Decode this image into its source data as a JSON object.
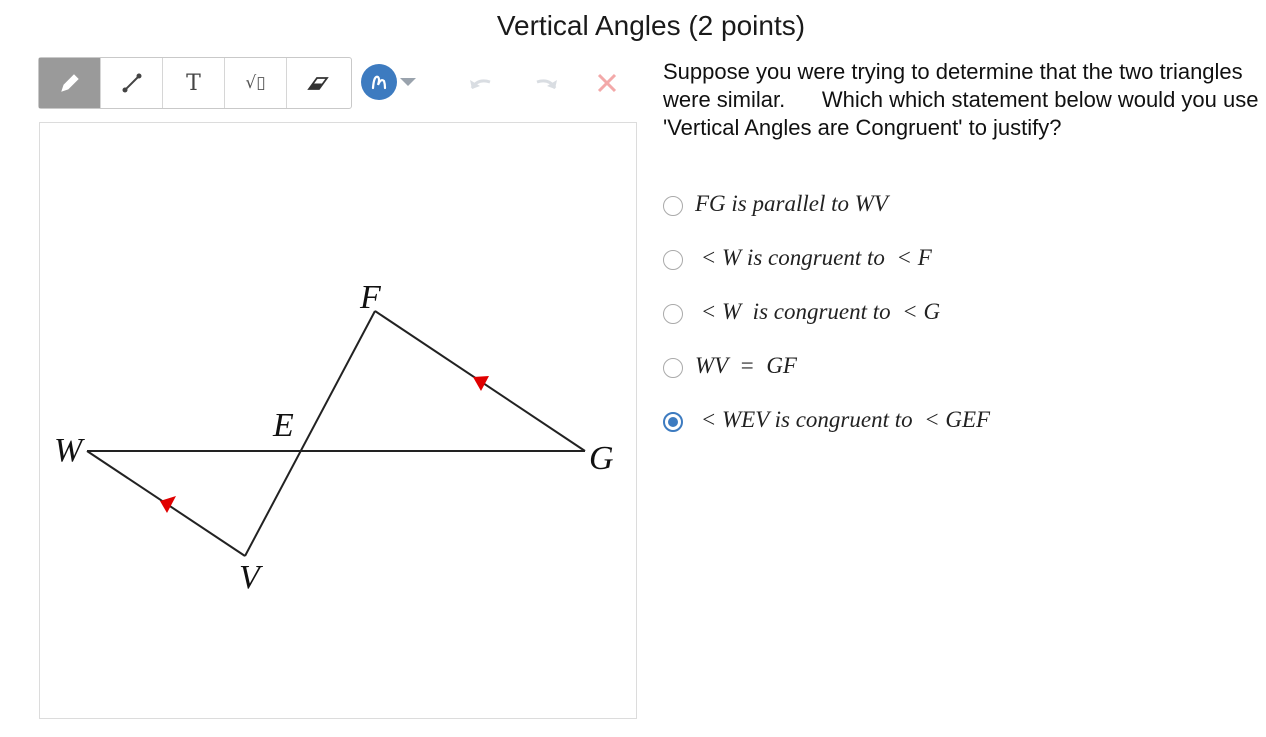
{
  "page": {
    "title": "Vertical Angles (2 points)"
  },
  "toolbar": {
    "tools": [
      {
        "name": "pencil",
        "icon": "pencil-icon",
        "active": true
      },
      {
        "name": "line",
        "icon": "line-icon"
      },
      {
        "name": "text",
        "icon": "text-icon",
        "label": "T"
      },
      {
        "name": "math",
        "icon": "sqrt-icon",
        "label": "√▯"
      },
      {
        "name": "eraser",
        "icon": "eraser-icon"
      }
    ],
    "color": "#3d7bc0",
    "undo_icon": "undo-icon",
    "redo_icon": "redo-icon",
    "clear_icon": "close-icon"
  },
  "diagram": {
    "points": [
      "W",
      "E",
      "F",
      "G",
      "V"
    ],
    "marker_color": "#e00000"
  },
  "question": {
    "text": "Suppose you were trying to determine that the two triangles were similar.      Which which statement below would you use 'Vertical Angles are Congruent' to justify?"
  },
  "options": [
    {
      "label": "FG is parallel to WV",
      "selected": false
    },
    {
      "label": " < W is congruent to  < F",
      "selected": false
    },
    {
      "label": " < W  is congruent to  < G",
      "selected": false
    },
    {
      "label": "WV  =  GF",
      "selected": false
    },
    {
      "label": " < WEV is congruent to  < GEF",
      "selected": true
    }
  ]
}
